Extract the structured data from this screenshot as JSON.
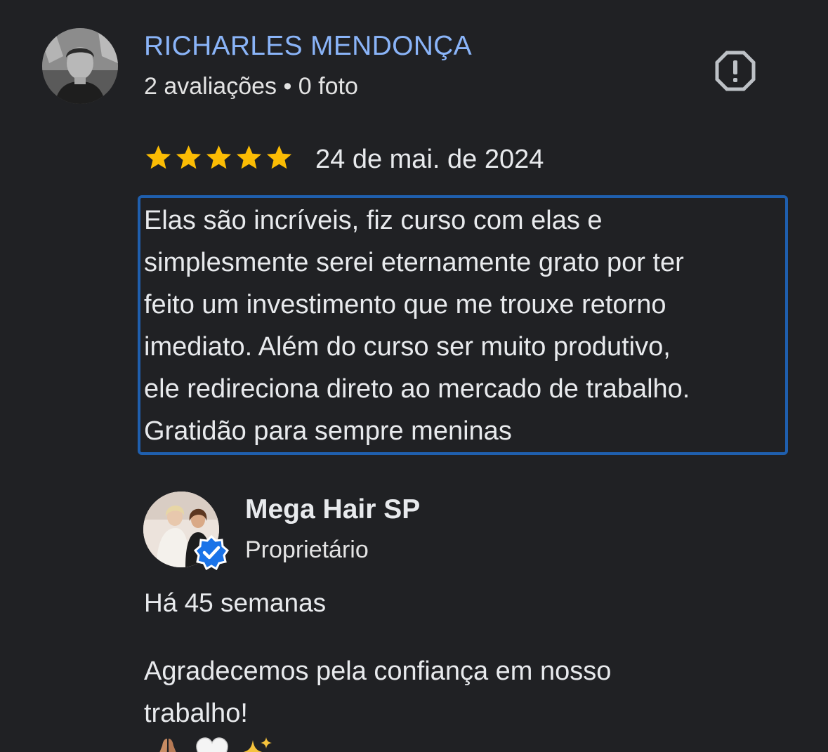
{
  "reviewer": {
    "name": "RICHARLES MENDONÇA",
    "meta": "2 avaliações • 0 foto"
  },
  "review": {
    "rating": 5,
    "rating_max": 5,
    "date": "24 de mai. de 2024",
    "lines": [
      "Elas são incríveis, fiz curso com elas e",
      "simplesmente serei eternamente grato por ter",
      "feito um investimento que me trouxe retorno",
      "imediato. Além do curso ser muito produtivo,",
      "ele redireciona direto ao mercado de trabalho.",
      "Gratidão para sempre meninas"
    ]
  },
  "owner_reply": {
    "name": "Mega Hair SP",
    "role": "Proprietário",
    "time": "Há 45 semanas",
    "lines": [
      "Agradecemos pela confiança em nosso",
      "trabalho!"
    ],
    "emojis": [
      "folded-hands",
      "white-heart",
      "sparkles"
    ]
  },
  "colors": {
    "background": "#202124",
    "reviewer_name": "#8ab4f8",
    "star": "#fbbc04",
    "highlight_border": "#1f5fae",
    "verified": "#1a73e8"
  },
  "icons": {
    "report": "report-icon",
    "verified": "verified-badge-icon"
  }
}
